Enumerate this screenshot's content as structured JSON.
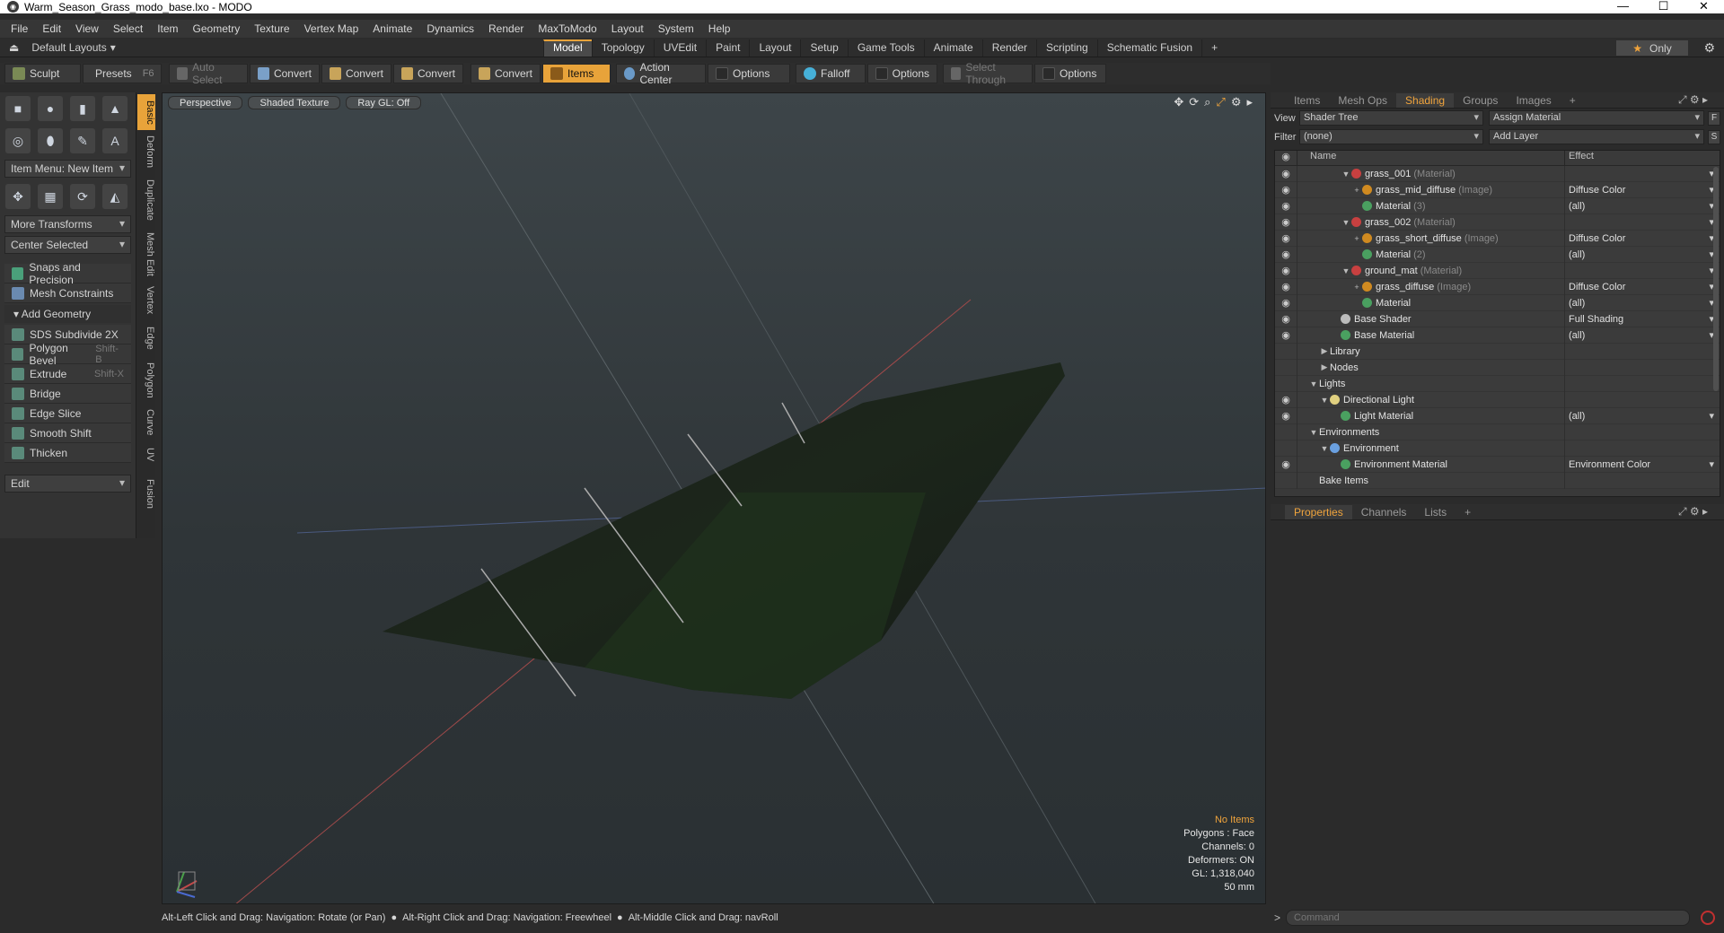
{
  "window": {
    "title": "Warm_Season_Grass_modo_base.lxo - MODO",
    "minimize": "—",
    "maximize": "☐",
    "close": "✕"
  },
  "menu": [
    "File",
    "Edit",
    "View",
    "Select",
    "Item",
    "Geometry",
    "Texture",
    "Vertex Map",
    "Animate",
    "Dynamics",
    "Render",
    "MaxToModo",
    "Layout",
    "System",
    "Help"
  ],
  "layouts": {
    "preset": "Default Layouts",
    "tabs": [
      "Model",
      "Topology",
      "UVEdit",
      "Paint",
      "Layout",
      "Setup",
      "Game Tools",
      "Animate",
      "Render",
      "Scripting",
      "Schematic Fusion"
    ],
    "active_tab": "Model",
    "only_label": "Only"
  },
  "toolbar": {
    "sculpt": "Sculpt",
    "presets": "Presets",
    "presets_key": "F6",
    "auto_select": "Auto Select",
    "convert": "Convert",
    "items": "Items",
    "action_center": "Action Center",
    "options": "Options",
    "falloff": "Falloff",
    "select_through": "Select Through"
  },
  "left_panel": {
    "item_menu": "Item Menu: New Item",
    "more_transforms": "More Transforms",
    "center_selected": "Center Selected",
    "snaps": "Snaps and Precision",
    "mesh_constraints": "Mesh Constraints",
    "add_geometry": "Add Geometry",
    "tools": [
      {
        "label": "SDS Subdivide 2X",
        "key": ""
      },
      {
        "label": "Polygon Bevel",
        "key": "Shift-B"
      },
      {
        "label": "Extrude",
        "key": "Shift-X"
      },
      {
        "label": "Bridge",
        "key": ""
      },
      {
        "label": "Edge Slice",
        "key": ""
      },
      {
        "label": "Smooth Shift",
        "key": ""
      },
      {
        "label": "Thicken",
        "key": ""
      }
    ],
    "edit": "Edit",
    "vertical_tabs": [
      "Basic",
      "Deform",
      "Duplicate",
      "Mesh Edit",
      "Vertex",
      "Edge",
      "Polygon",
      "Curve",
      "UV",
      "Fusion"
    ]
  },
  "viewport": {
    "view": "Perspective",
    "shading": "Shaded Texture",
    "raygl": "Ray GL: Off",
    "stats": {
      "items": "No Items",
      "polygons": "Polygons : Face",
      "channels": "Channels: 0",
      "deformers": "Deformers: ON",
      "gl": "GL: 1,318,040",
      "lens": "50 mm"
    }
  },
  "statusline": {
    "hint1": "Alt-Left Click and Drag: Navigation: Rotate (or Pan)",
    "hint2": "Alt-Right Click and Drag: Navigation: Freewheel",
    "hint3": "Alt-Middle Click and Drag: navRoll"
  },
  "right_panel": {
    "tabs": [
      "Items",
      "Mesh Ops",
      "Shading",
      "Groups",
      "Images"
    ],
    "active_tab": "Shading",
    "view_label": "View",
    "view_value": "Shader Tree",
    "assign_material": "Assign Material",
    "filter_label": "Filter",
    "filter_value": "(none)",
    "add_layer": "Add Layer",
    "f_btn": "F",
    "s_btn": "S",
    "tree_header": {
      "name": "Name",
      "effect": "Effect"
    },
    "tree": [
      {
        "indent": 3,
        "tw": "▼",
        "icon": "material",
        "name": "grass_001",
        "type": "(Material)",
        "effect": "",
        "eye": true
      },
      {
        "indent": 4,
        "tw": "+",
        "icon": "image",
        "name": "grass_mid_diffuse",
        "type": "(Image)",
        "effect": "Diffuse Color",
        "eye": true
      },
      {
        "indent": 4,
        "tw": "",
        "icon": "matsphere",
        "name": "Material",
        "type": "(3)",
        "effect": "(all)",
        "eye": true
      },
      {
        "indent": 3,
        "tw": "▼",
        "icon": "material",
        "name": "grass_002",
        "type": "(Material)",
        "effect": "",
        "eye": true
      },
      {
        "indent": 4,
        "tw": "+",
        "icon": "image",
        "name": "grass_short_diffuse",
        "type": "(Image)",
        "effect": "Diffuse Color",
        "eye": true
      },
      {
        "indent": 4,
        "tw": "",
        "icon": "matsphere",
        "name": "Material",
        "type": "(2)",
        "effect": "(all)",
        "eye": true
      },
      {
        "indent": 3,
        "tw": "▼",
        "icon": "material",
        "name": "ground_mat",
        "type": "(Material)",
        "effect": "",
        "eye": true
      },
      {
        "indent": 4,
        "tw": "+",
        "icon": "image",
        "name": "grass_diffuse",
        "type": "(Image)",
        "effect": "Diffuse Color",
        "eye": true
      },
      {
        "indent": 4,
        "tw": "",
        "icon": "matsphere",
        "name": "Material",
        "type": "",
        "effect": "(all)",
        "eye": true
      },
      {
        "indent": 2,
        "tw": "",
        "icon": "shader",
        "name": "Base Shader",
        "type": "",
        "effect": "Full Shading",
        "eye": true
      },
      {
        "indent": 2,
        "tw": "",
        "icon": "matsphere",
        "name": "Base Material",
        "type": "",
        "effect": "(all)",
        "eye": true
      },
      {
        "indent": 1,
        "tw": "▶",
        "icon": "",
        "name": "Library",
        "type": "",
        "effect": "",
        "eye": false
      },
      {
        "indent": 1,
        "tw": "▶",
        "icon": "",
        "name": "Nodes",
        "type": "",
        "effect": "",
        "eye": false
      },
      {
        "indent": 0,
        "tw": "▼",
        "icon": "",
        "name": "Lights",
        "type": "",
        "effect": "",
        "eye": false
      },
      {
        "indent": 1,
        "tw": "▼",
        "icon": "light",
        "name": "Directional Light",
        "type": "",
        "effect": "",
        "eye": true
      },
      {
        "indent": 2,
        "tw": "",
        "icon": "matsphere",
        "name": "Light Material",
        "type": "",
        "effect": "(all)",
        "eye": true
      },
      {
        "indent": 0,
        "tw": "▼",
        "icon": "",
        "name": "Environments",
        "type": "",
        "effect": "",
        "eye": false
      },
      {
        "indent": 1,
        "tw": "▼",
        "icon": "env",
        "name": "Environment",
        "type": "",
        "effect": "",
        "eye": false
      },
      {
        "indent": 2,
        "tw": "",
        "icon": "matsphere",
        "name": "Environment Material",
        "type": "",
        "effect": "Environment Color",
        "eye": true
      },
      {
        "indent": 0,
        "tw": "",
        "icon": "",
        "name": "Bake Items",
        "type": "",
        "effect": "",
        "eye": false
      }
    ],
    "props_tabs": [
      "Properties",
      "Channels",
      "Lists"
    ],
    "props_active": "Properties",
    "command_placeholder": "Command"
  },
  "colors": {
    "accent": "#f0a43c",
    "tab_active": "#e8a33a"
  }
}
